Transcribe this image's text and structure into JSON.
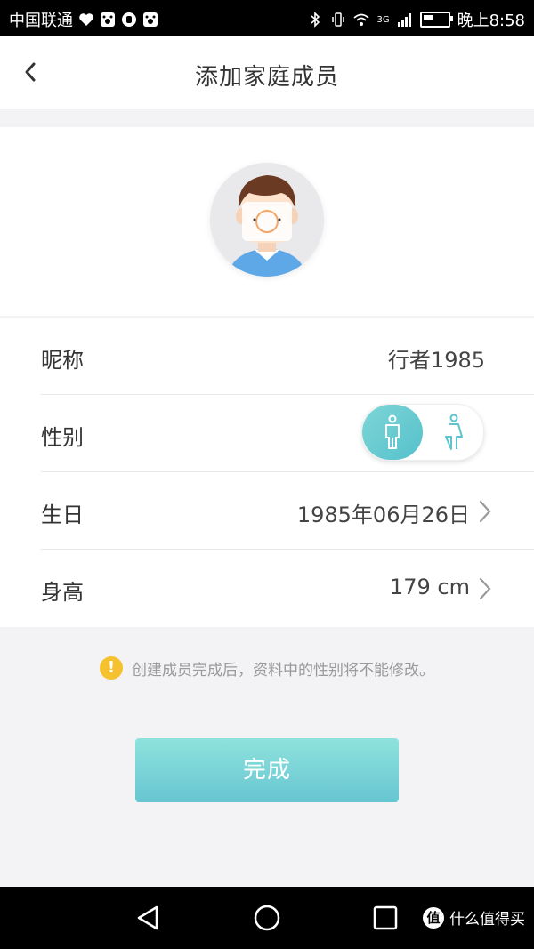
{
  "status_bar": {
    "carrier": "中国联通",
    "network": "3G",
    "time": "晚上8:58"
  },
  "header": {
    "title": "添加家庭成员"
  },
  "form": {
    "rows": [
      {
        "label": "昵称",
        "value": "行者1985"
      },
      {
        "label": "性别",
        "selected": "male"
      },
      {
        "label": "生日",
        "value": "1985年06月26日"
      },
      {
        "label": "身高",
        "value": "179 cm"
      }
    ]
  },
  "notice": {
    "icon": "!",
    "text": "创建成员完成后，资料中的性别将不能修改。"
  },
  "done_button": {
    "label": "完成"
  },
  "watermark": {
    "badge": "值",
    "text": "什么值得买"
  },
  "colors": {
    "accent": "#5ec3ce",
    "warning": "#f5c12e"
  }
}
